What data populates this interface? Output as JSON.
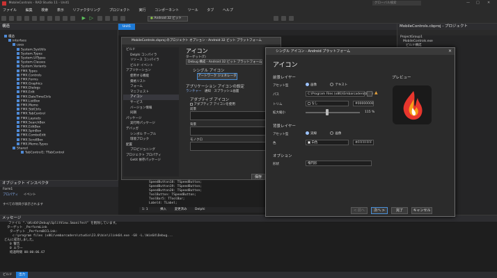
{
  "title": "MobileControls - RAD Studio 11 - Unit1",
  "search_placeholder": "グローバル検索",
  "menu": [
    "ファイル",
    "編集",
    "検索",
    "表示",
    "リファクタリング",
    "プロジェクト",
    "実行",
    "コンポーネント",
    "ツール",
    "タブ",
    "ヘルプ"
  ],
  "platform": "Android 32 ビット",
  "editor_tab": "Unit1",
  "structure": {
    "title": "構造",
    "items": [
      "構造",
      "interface",
      "uses",
      "System.SysUtils",
      "System.Types",
      "System.UITypes",
      "System.Classes",
      "System.Variants",
      "FMX.Types",
      "FMX.Controls",
      "FMX.Forms",
      "FMX.Graphics",
      "FMX.Dialogs",
      "FMX.Edit",
      "FMX.DateTimeCtrls",
      "FMX.ListBox",
      "FMX.Memo",
      "FMX.StdCtrls",
      "FMX.TabControl",
      "FMX.Layouts",
      "FMX.SearchBox",
      "FMX.EditBox",
      "FMX.SpinBox",
      "FMX.ComboEdit",
      "FMX.ScrollBox",
      "FMX.Memo.Types",
      "Shared",
      "TabControl1: TTabControl"
    ]
  },
  "object_inspector": {
    "title": "オブジェクト インスペクタ",
    "component": "Form1",
    "tabs": [
      "プロパティ",
      "イベント"
    ],
    "filter": "すべての項目が表示されます"
  },
  "messages": {
    "title": "メッセージ",
    "lines": [
      "ファイル \".\\Win64\\Debug\\SplitView.Smanifest\" を削除しています。",
      "ターゲット _PerformLink",
      "ターゲット _PerformBCCLink:",
      "c:\\program files (x86)\\embarcadero\\studio\\23.0\\bin\\ilink64.exe -G8 -L.\\Win64\\Debug...",
      "どんに成功しました。",
      "0 警告",
      "0 エラー",
      "経過時間 00:00:06.67"
    ],
    "tabs": [
      "ビルド",
      "出力"
    ]
  },
  "project_options": {
    "title": "MobileControls.cbproj のプロジェクト オプション - Android 32 ビット プラットフォーム",
    "tree": [
      "ビルド",
      "Delphi コンパイラ",
      "リソース コンパイラ",
      "ビルド イベント",
      "アプリケーション",
      "使用する機能",
      "資格リスト",
      "フォーム",
      "マニフェスト",
      "アイコン",
      "サービス",
      "バージョン情報",
      "同期",
      "パッケージ",
      "実行時パッケージ",
      "デバッガ",
      "シンボル テーブル",
      "環境ブロック",
      "配置",
      "プロビジョニング",
      "プロジェクト プロパティ",
      "Getit 依存パッケージ"
    ],
    "heading": "アイコン",
    "target_label": "ターゲット(T)",
    "target_value": "Debug 構成 - Android 32 ビット プラットフォーム",
    "single_icon": "シングル アイコン",
    "artwork_button": "アートワーク ジェネレータ",
    "app_icon_settings": "アプリケーション アイコンの設定",
    "launcher": "ランチャー",
    "notification": "通知",
    "splash": "スプラッシュ画面",
    "adaptive_icon": "アダプティブ アイコン",
    "use_adaptive": "アダプティブ アイコンを使用",
    "foreground": "前景",
    "background": "背景",
    "monochrome": "モノクロ",
    "save_button": "保存"
  },
  "icon_dialog": {
    "title": "シングル アイコン - Android プラットフォーム",
    "heading": "アイコン",
    "fg_layer": "前景レイヤー",
    "asset_type": "アセット型",
    "image": "画像",
    "text": "テキスト",
    "path_label": "パス",
    "path_value": "C:\\Program Files (x86)\\Embarcadero\\Studi",
    "trim_label": "トリム",
    "trim_value": "なし",
    "trim_color": "#00000000",
    "scale_label": "拡大縮小",
    "scale_value": "115 %",
    "scale_fraction": 0.4,
    "bg_layer": "背景レイヤー",
    "solid": "実線",
    "color_label": "色",
    "color_value": "白色",
    "color_hex": "#FFFFFFFF",
    "options": "オプション",
    "shape_label": "形状",
    "shape_value": "楕円形",
    "preview": "プレビュー",
    "buttons": [
      "< 前へ",
      "次へ >",
      "完了",
      "キャンセル"
    ]
  },
  "right_panel": {
    "title": "MobileControls.cbproj - プロジェクト",
    "items": [
      "ProjectGroup1",
      "MobileControls.exe",
      "ビルド構成",
      "ターゲット プラットフォーム",
      "Android 32 ビット",
      "Android 64 ビット",
      "Windows 32 ビット",
      "Windows 64 ビット",
      "macOS 64 ビット",
      "iOS デバイス 64 ビット",
      "Linux 64 ビット",
      "Unit1.pas",
      "Unit1.fmx"
    ]
  },
  "code_lines": [
    "SpeedButton17: TSpeedButton;",
    "SpeedButton18: TSpeedButton;",
    "SpeedButton19: TSpeedButton;",
    "SpeedButton20: TSpeedButton;",
    "ToolButton: TSpeedButton;",
    "ToolBar5: TToolBar;",
    "Label4: TLabel;"
  ],
  "editor_status": {
    "pos": "1: 1",
    "mode": "挿入",
    "modified": "変更済み",
    "lang": "Delphi"
  },
  "status_tabs": [
    "ビルド",
    "出力"
  ]
}
